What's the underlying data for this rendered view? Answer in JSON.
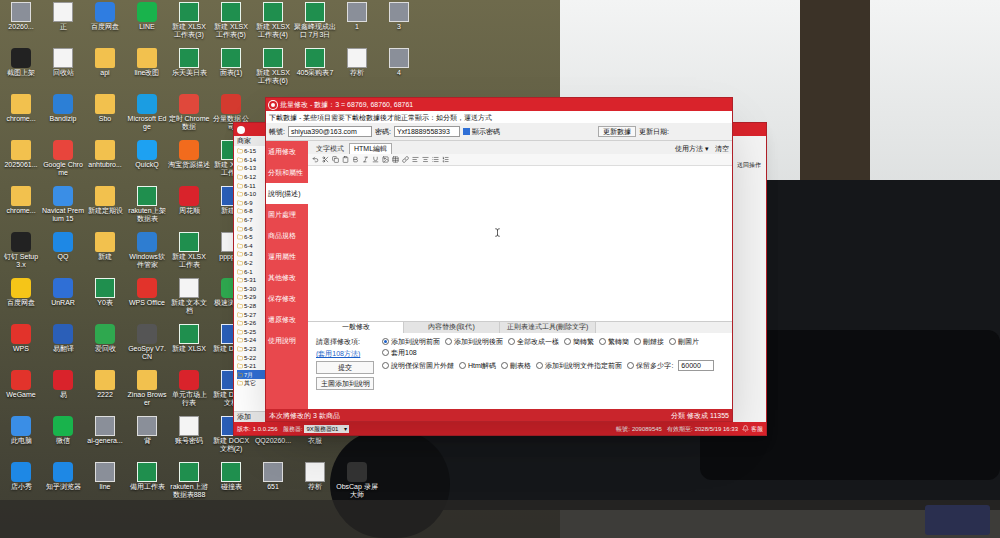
{
  "desktop_icons": [
    [
      {
        "label": "20260...",
        "kind": "image"
      },
      {
        "label": "正",
        "kind": "file"
      },
      {
        "label": "百度网盘",
        "kind": "app",
        "color": "#2f7de1"
      },
      {
        "label": "LINE",
        "kind": "app",
        "color": "#19b34c"
      },
      {
        "label": "新建 XLSX 工作表(3)",
        "kind": "xlsx"
      },
      {
        "label": "新建 XLSX 工作表(5)",
        "kind": "xlsx"
      },
      {
        "label": "新建 XLSX 工作表(4)",
        "kind": "xlsx"
      },
      {
        "label": "聚鑫峰现成出口 7月3日",
        "kind": "xlsx"
      },
      {
        "label": "1",
        "kind": "image"
      },
      {
        "label": "3",
        "kind": "image"
      }
    ],
    [
      {
        "label": "截图上架",
        "kind": "app",
        "color": "#222222"
      },
      {
        "label": "回收站",
        "kind": "file"
      },
      {
        "label": "api",
        "kind": "folder"
      },
      {
        "label": "line改图",
        "kind": "folder"
      },
      {
        "label": "乐天美日表",
        "kind": "xlsx"
      },
      {
        "label": "面表(1)",
        "kind": "xlsx"
      },
      {
        "label": "新建 XLSX 工作表(6)",
        "kind": "xlsx"
      },
      {
        "label": "405采购表7",
        "kind": "xlsx"
      },
      {
        "label": "荐析",
        "kind": "file"
      },
      {
        "label": "4",
        "kind": "image"
      }
    ],
    [
      {
        "label": "chrome...",
        "kind": "folder"
      },
      {
        "label": "Bandizip",
        "kind": "app",
        "color": "#2c7fd6"
      },
      {
        "label": "Sbo",
        "kind": "folder"
      },
      {
        "label": "Microsoft Edge",
        "kind": "app",
        "color": "#1b9de2"
      },
      {
        "label": "定时 Chrome 数据",
        "kind": "app",
        "color": "#e0483b"
      },
      {
        "label": "分量数据 公司",
        "kind": "app",
        "color": "#d43a2f"
      }
    ],
    [
      {
        "label": "2025061...",
        "kind": "folder"
      },
      {
        "label": "Google Chrome",
        "kind": "app",
        "color": "#e8453c"
      },
      {
        "label": "anhtubro...",
        "kind": "folder"
      },
      {
        "label": "QuickQ",
        "kind": "app",
        "color": "#1da1f2"
      },
      {
        "label": "淘宝货源描述",
        "kind": "app",
        "color": "#f26b1d"
      },
      {
        "label": "新建 XLSX 工作表",
        "kind": "xlsx"
      }
    ],
    [
      {
        "label": "chrome...",
        "kind": "folder"
      },
      {
        "label": "Navicat Premium 15",
        "kind": "app",
        "color": "#3a8ee6"
      },
      {
        "label": "新建定期设",
        "kind": "folder"
      },
      {
        "label": "rakuten上架 数据表",
        "kind": "xlsx"
      },
      {
        "label": "周花顺",
        "kind": "app",
        "color": "#d9232b"
      },
      {
        "label": "新建表",
        "kind": "docx"
      }
    ],
    [
      {
        "label": "钉钉 Setup 3.x",
        "kind": "app",
        "color": "#222222"
      },
      {
        "label": "QQ",
        "kind": "app",
        "color": "#1e88e5"
      },
      {
        "label": "新建",
        "kind": "folder"
      },
      {
        "label": "Windows软件管家",
        "kind": "app",
        "color": "#2e7dd1"
      },
      {
        "label": "新建 XLSX 工作表",
        "kind": "xlsx"
      },
      {
        "label": "pppppp",
        "kind": "file"
      }
    ],
    [
      {
        "label": "百度网盘",
        "kind": "app",
        "color": "#f5c518"
      },
      {
        "label": "UnRAR",
        "kind": "app",
        "color": "#2f6fd6"
      },
      {
        "label": "Y0表",
        "kind": "xlsx"
      },
      {
        "label": "WPS Office",
        "kind": "app",
        "color": "#e2332b"
      },
      {
        "label": "新建 文本文档",
        "kind": "file"
      },
      {
        "label": "极速浏览器",
        "kind": "app",
        "color": "#2fa84f"
      }
    ],
    [
      {
        "label": "WPS",
        "kind": "app",
        "color": "#e2332b"
      },
      {
        "label": "易翻译",
        "kind": "app",
        "color": "#2b5fb8"
      },
      {
        "label": "爱回收",
        "kind": "app",
        "color": "#2fa84f"
      },
      {
        "label": "GeoSpy V7.CN",
        "kind": "app",
        "color": "#555555"
      },
      {
        "label": "新建 XLSX",
        "kind": "xlsx"
      },
      {
        "label": "新建 DOCX",
        "kind": "docx"
      }
    ],
    [
      {
        "label": "WeGame",
        "kind": "app",
        "color": "#e2332b"
      },
      {
        "label": "易",
        "kind": "app",
        "color": "#d9232b"
      },
      {
        "label": "2222",
        "kind": "folder"
      },
      {
        "label": "Zinao Browser",
        "kind": "folder"
      },
      {
        "label": "单元市场上 行表",
        "kind": "app",
        "color": "#d9232b"
      },
      {
        "label": "新建 DOCX 文档",
        "kind": "docx"
      }
    ],
    [
      {
        "label": "此电脑",
        "kind": "app",
        "color": "#3a8ee6"
      },
      {
        "label": "微信",
        "kind": "app",
        "color": "#19b34c"
      },
      {
        "label": "ai-genera...",
        "kind": "image"
      },
      {
        "label": "背",
        "kind": "image"
      },
      {
        "label": "账号密码",
        "kind": "file"
      },
      {
        "label": "新建 DOCX 文档(2)",
        "kind": "docx"
      },
      {
        "label": "QQ20260...",
        "kind": "image"
      },
      {
        "label": "衣服",
        "kind": "file"
      }
    ],
    [
      {
        "label": "店小秀",
        "kind": "app",
        "color": "#1e88e5"
      },
      {
        "label": "知乎浏览器",
        "kind": "app",
        "color": "#1e88e5"
      },
      {
        "label": "line",
        "kind": "image"
      },
      {
        "label": "備用工作表",
        "kind": "xlsx"
      },
      {
        "label": "rakuten上游 数据表888",
        "kind": "xlsx"
      },
      {
        "label": "碰撞表",
        "kind": "xlsx"
      },
      {
        "label": "651",
        "kind": "image"
      },
      {
        "label": "荐析",
        "kind": "file"
      },
      {
        "label": "ObsCap 录屏大师",
        "kind": "app",
        "color": "#333333"
      }
    ]
  ],
  "back_window": {
    "header": "商家",
    "tree": [
      {
        "label": "6-15",
        "selected": false
      },
      {
        "label": "6-14",
        "selected": false
      },
      {
        "label": "6-13",
        "selected": false
      },
      {
        "label": "6-12",
        "selected": false
      },
      {
        "label": "6-11",
        "selected": false
      },
      {
        "label": "6-10",
        "selected": false
      },
      {
        "label": "6-9",
        "selected": false
      },
      {
        "label": "6-8",
        "selected": false
      },
      {
        "label": "6-7",
        "selected": false
      },
      {
        "label": "6-6",
        "selected": false
      },
      {
        "label": "6-5",
        "selected": false
      },
      {
        "label": "6-4",
        "selected": false
      },
      {
        "label": "6-3",
        "selected": false
      },
      {
        "label": "6-2",
        "selected": false
      },
      {
        "label": "6-1",
        "selected": false
      },
      {
        "label": "5-31",
        "selected": false
      },
      {
        "label": "5-30",
        "selected": false
      },
      {
        "label": "5-29",
        "selected": false
      },
      {
        "label": "5-28",
        "selected": false
      },
      {
        "label": "5-27",
        "selected": false
      },
      {
        "label": "5-26",
        "selected": false
      },
      {
        "label": "5-25",
        "selected": false
      },
      {
        "label": "5-24",
        "selected": false
      },
      {
        "label": "5-23",
        "selected": false
      },
      {
        "label": "5-22",
        "selected": false
      },
      {
        "label": "5-21",
        "selected": false
      },
      {
        "label": "7月",
        "selected": true
      },
      {
        "label": "其它",
        "selected": false
      }
    ],
    "add_button": "添加",
    "right_label": "送回操作",
    "footer": {
      "version_label": "版本:",
      "version": "1.0.0.256",
      "server_label": "服務器:",
      "server": "9X服務器01",
      "dropdown": "▾",
      "account_label": "帳號:",
      "account": "209089545",
      "expiry_label": "有效期至:",
      "expiry": "2028/5/19 16:33",
      "support": "客服"
    }
  },
  "window": {
    "title": "批量修改 - 數據：3 = 68769, 68760, 68761",
    "info": "下載數據 - 某些項目需要下載檢數據後才能正常顯示：如分類，運送方式",
    "account": {
      "user_label": "帳號:",
      "user": "shiyua390@163.com",
      "password_label": "密碼:",
      "password": "Yxf18889558393",
      "show_password": {
        "label": "顯示密碼",
        "checked": true
      },
      "update_button": "更新數據",
      "update_date_label": "更新日期:"
    },
    "nav": [
      {
        "label": "通用修改",
        "selected": false
      },
      {
        "label": "分類和屬性",
        "selected": false
      },
      {
        "label": "說明(描述)",
        "selected": true
      },
      {
        "label": "圖片處理",
        "selected": false
      },
      {
        "label": "商品規格",
        "selected": false
      },
      {
        "label": "運用屬性",
        "selected": false
      },
      {
        "label": "其他修改",
        "selected": false
      },
      {
        "label": "保存修改",
        "selected": false
      },
      {
        "label": "還原修改",
        "selected": false
      },
      {
        "label": "使用說明",
        "selected": false
      }
    ],
    "editor": {
      "tabs": [
        {
          "label": "文字模式",
          "selected": false
        },
        {
          "label": "HTML編輯",
          "selected": true
        }
      ],
      "help": "使用方法",
      "help_arrow": "▾",
      "clear": "清空"
    },
    "panel": {
      "tabs": [
        {
          "label": "一般修改",
          "selected": true
        },
        {
          "label": "內容替換(取代)",
          "selected": false
        },
        {
          "label": "正則表達式工具(刪除文字)",
          "selected": false
        }
      ],
      "prompt": "請選擇修改項:",
      "link": "(套用108方法)",
      "submit": "提交",
      "main_image_button": "主圖添加到說明",
      "options_row1": [
        {
          "label": "添加到說明前面",
          "selected": true
        },
        {
          "label": "添加到說明後面",
          "selected": false
        },
        {
          "label": "全部改成一樣",
          "selected": false
        },
        {
          "label": "簡轉繁",
          "selected": false
        },
        {
          "label": "繁轉簡",
          "selected": false
        },
        {
          "label": "刪鏈接",
          "selected": false
        },
        {
          "label": "刪圖片",
          "selected": false
        },
        {
          "label": "套用108",
          "selected": false
        }
      ],
      "options_row2": [
        {
          "label": "說明僅保留圖片外鏈",
          "selected": false
        },
        {
          "label": "Html解碼",
          "selected": false
        },
        {
          "label": "刪表格",
          "selected": false
        },
        {
          "label": "添加到說明文件指定前面",
          "selected": false
        },
        {
          "label": "保留多少字:",
          "selected": false
        }
      ],
      "keep_chars": "60000"
    },
    "status": {
      "left": "本次將修改的 3 款商品",
      "right": "分類 修改成 11355"
    }
  }
}
